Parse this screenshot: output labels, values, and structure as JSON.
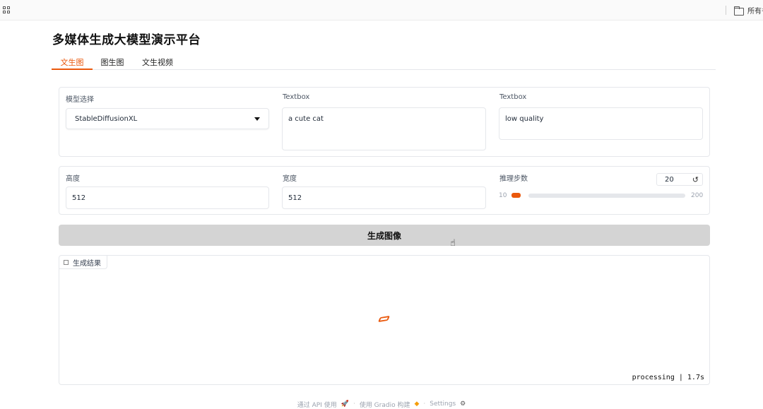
{
  "browser": {
    "bookmarks_label": "所有书"
  },
  "app": {
    "title": "多媒体生成大模型演示平台",
    "tabs": [
      {
        "label": "文生图",
        "active": true
      },
      {
        "label": "图生图",
        "active": false
      },
      {
        "label": "文生视频",
        "active": false
      }
    ]
  },
  "form": {
    "model": {
      "label": "模型选择",
      "value": "StableDiffusionXL"
    },
    "prompt": {
      "label": "Textbox",
      "value": "a cute cat"
    },
    "negative": {
      "label": "Textbox",
      "value": "low quality"
    },
    "height": {
      "label": "高度",
      "value": "512"
    },
    "width": {
      "label": "宽度",
      "value": "512"
    },
    "steps": {
      "label": "推理步数",
      "value": "20",
      "min": "10",
      "max": "200"
    }
  },
  "generate_button": "生成图像",
  "result": {
    "label": "生成结果",
    "status": "processing | 1.7s"
  },
  "footer": {
    "api_link": "通过 API 使用",
    "gradio_link": "使用 Gradio 构建",
    "settings_link": "Settings"
  },
  "colors": {
    "accent": "#ea580c",
    "button_bg": "#d4d4d4"
  }
}
